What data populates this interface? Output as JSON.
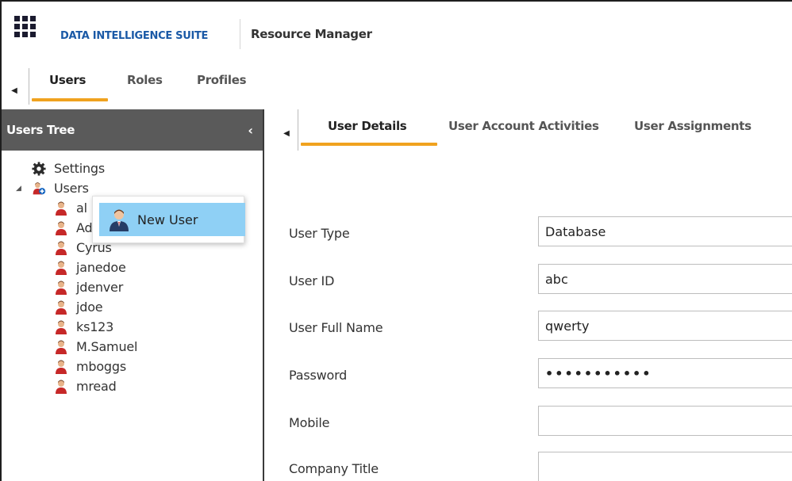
{
  "header": {
    "suite_name": "DATA INTELLIGENCE SUITE",
    "page_name": "Resource Manager",
    "app_icon": "app-grid-icon"
  },
  "primary_tabs": [
    {
      "label": "Users",
      "active": true
    },
    {
      "label": "Roles",
      "active": false
    },
    {
      "label": "Profiles",
      "active": false
    }
  ],
  "tree": {
    "title": "Users Tree",
    "collapse_glyph": "‹",
    "settings_label": "Settings",
    "users_label": "Users",
    "users": [
      {
        "label": "al"
      },
      {
        "label": "Administrator"
      },
      {
        "label": "Cyrus"
      },
      {
        "label": "janedoe"
      },
      {
        "label": "jdenver"
      },
      {
        "label": "jdoe"
      },
      {
        "label": "ks123"
      },
      {
        "label": "M.Samuel"
      },
      {
        "label": "mboggs"
      },
      {
        "label": "mread"
      }
    ]
  },
  "context_menu": {
    "new_user_label": "New User"
  },
  "detail_tabs": [
    {
      "label": "User Details",
      "active": true
    },
    {
      "label": "User Account Activities",
      "active": false
    },
    {
      "label": "User Assignments",
      "active": false
    }
  ],
  "form": {
    "user_type": {
      "label": "User Type",
      "value": "Database"
    },
    "user_id": {
      "label": "User ID",
      "value": "abc"
    },
    "user_full_name": {
      "label": "User Full Name",
      "value": "qwerty"
    },
    "password": {
      "label": "Password",
      "value": "•••••••••••"
    },
    "mobile": {
      "label": "Mobile",
      "value": ""
    },
    "company_title": {
      "label": "Company Title",
      "value": ""
    }
  },
  "colors": {
    "accent": "#f0a21f",
    "suite_name": "#1a59a6",
    "tree_header": "#5a5a5a",
    "menu_highlight": "#8fd0f5"
  }
}
